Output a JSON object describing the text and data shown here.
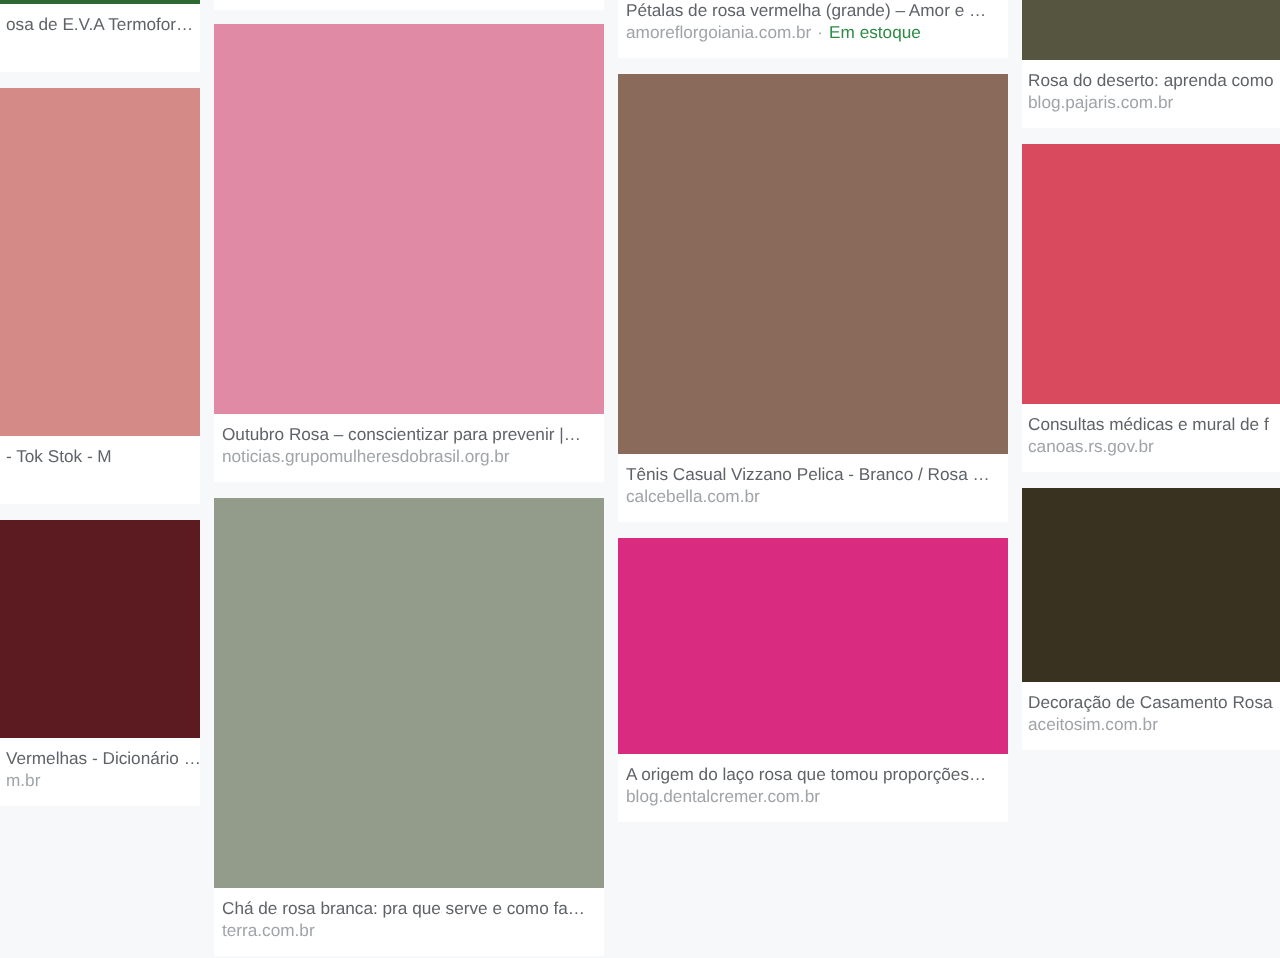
{
  "columns": [
    {
      "results": [
        {
          "color": "#2d6a31",
          "caption": "osa de E.V.A Termofor…"
        },
        {
          "color": "#d48a87",
          "caption": "- Tok Stok - M"
        },
        {
          "color": "#5c1b20",
          "caption": "Vermelhas - Dicionário …",
          "domain": "m.br"
        }
      ]
    },
    {
      "results": [
        {
          "color": "#e08aa6",
          "caption": "Outubro Rosa – conscientizar para prevenir |…",
          "domain": "noticias.grupomulheresdobrasil.org.br"
        },
        {
          "color": "#939c8a",
          "caption": "Chá de rosa branca: pra que serve e como fa…",
          "domain": "terra.com.br"
        }
      ]
    },
    {
      "results": [
        {
          "caption": "Pétalas de rosa vermelha (grande) – Amor e …",
          "domain": "amoreflorgoiania.com.br",
          "separator": "·",
          "stock": "Em estoque"
        },
        {
          "color": "#8a6a5a",
          "caption": "Tênis Casual Vizzano Pelica - Branco / Rosa …",
          "domain": "calcebella.com.br"
        },
        {
          "color": "#d92b80",
          "caption": "A origem do laço rosa que tomou proporções…",
          "domain": "blog.dentalcremer.com.br"
        }
      ]
    },
    {
      "results": [
        {
          "color": "#555540",
          "caption": "Rosa do deserto: aprenda como",
          "domain": "blog.pajaris.com.br"
        },
        {
          "color": "#d94a5e",
          "caption": "Consultas médicas e mural de f",
          "domain": "canoas.rs.gov.br"
        },
        {
          "color": "#3a3220",
          "caption": "Decoração de Casamento Rosa",
          "domain": "aceitosim.com.br"
        }
      ]
    }
  ]
}
